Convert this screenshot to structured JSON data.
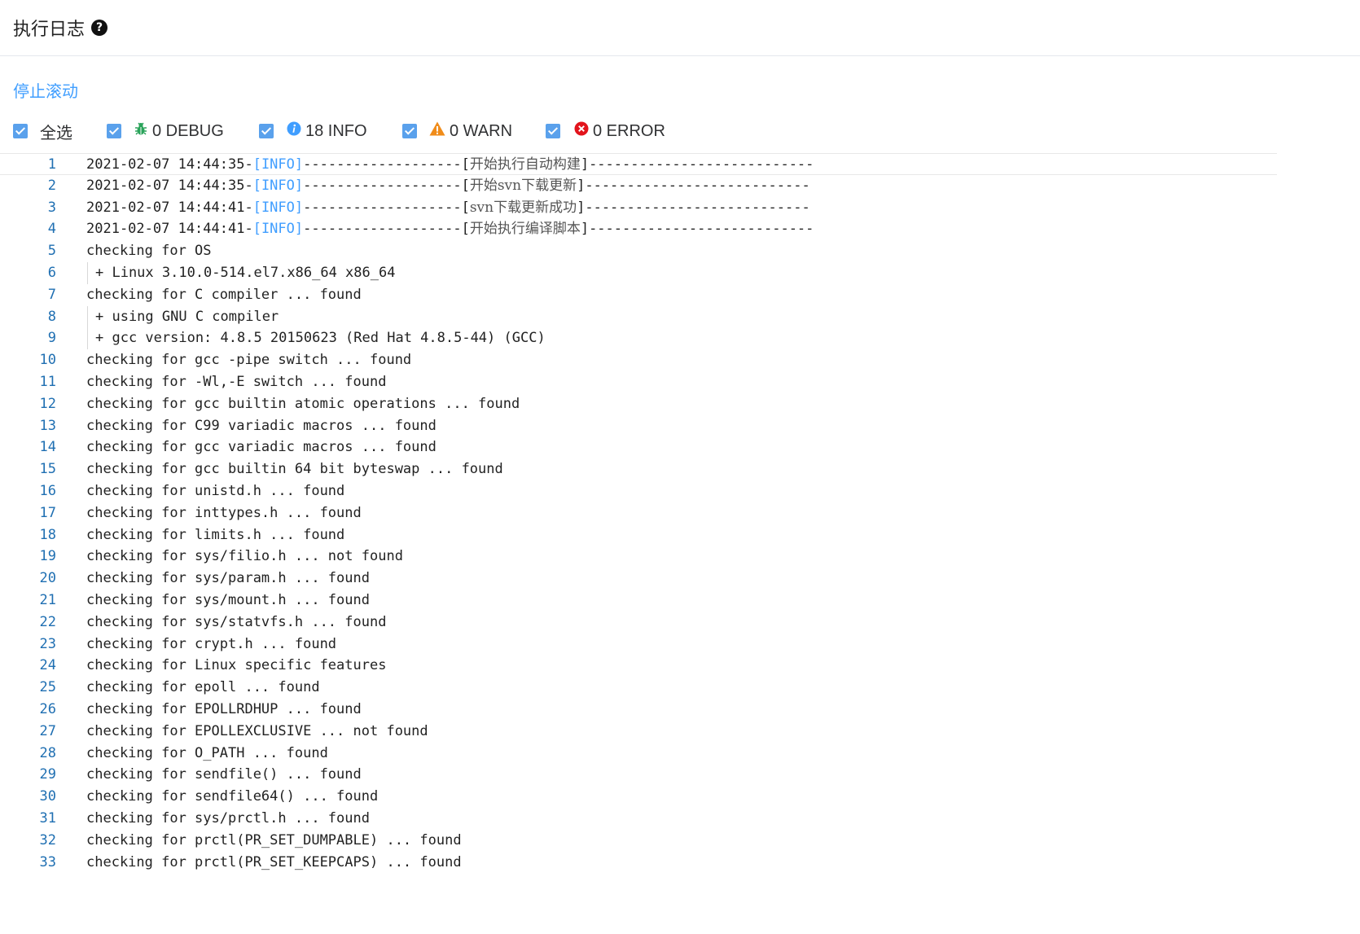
{
  "header": {
    "title": "执行日志",
    "help_icon": "question-circle-icon"
  },
  "toolbar": {
    "stop_scroll": "停止滚动"
  },
  "filters": {
    "select_all": "全选",
    "items": [
      {
        "icon": "bug-icon",
        "label": "0 DEBUG",
        "color": "#2aa35a"
      },
      {
        "icon": "info-circle-icon",
        "label": "18 INFO",
        "color": "#409eff"
      },
      {
        "icon": "warning-triangle-icon",
        "label": "0 WARN",
        "color": "#f08c1a"
      },
      {
        "icon": "error-circle-icon",
        "label": "0 ERROR",
        "color": "#e2141c"
      }
    ]
  },
  "colors": {
    "accent": "#409eff",
    "checkbox": "#5aa1ec",
    "line_number": "#1f6fb2"
  },
  "log": {
    "lines": [
      {
        "n": "1",
        "ts": "2021-02-07 14:44:35-",
        "tag": "[INFO]",
        "dash1": "-------------------[",
        "cn": "开始执行自动构建",
        "dash2": "]---------------------------"
      },
      {
        "n": "2",
        "ts": "2021-02-07 14:44:35-",
        "tag": "[INFO]",
        "dash1": "-------------------[",
        "cn": "开始svn下载更新",
        "dash2": "]---------------------------"
      },
      {
        "n": "3",
        "ts": "2021-02-07 14:44:41-",
        "tag": "[INFO]",
        "dash1": "-------------------[",
        "cn": "svn下载更新成功",
        "dash2": "]---------------------------"
      },
      {
        "n": "4",
        "ts": "2021-02-07 14:44:41-",
        "tag": "[INFO]",
        "dash1": "-------------------[",
        "cn": "开始执行编译脚本",
        "dash2": "]---------------------------"
      },
      {
        "n": "5",
        "text": "checking for OS"
      },
      {
        "n": "6",
        "text": " + Linux 3.10.0-514.el7.x86_64 x86_64",
        "indent": true
      },
      {
        "n": "7",
        "text": "checking for C compiler ... found"
      },
      {
        "n": "8",
        "text": " + using GNU C compiler",
        "indent": true
      },
      {
        "n": "9",
        "text": " + gcc version: 4.8.5 20150623 (Red Hat 4.8.5-44) (GCC)",
        "indent": true
      },
      {
        "n": "10",
        "text": "checking for gcc -pipe switch ... found"
      },
      {
        "n": "11",
        "text": "checking for -Wl,-E switch ... found"
      },
      {
        "n": "12",
        "text": "checking for gcc builtin atomic operations ... found"
      },
      {
        "n": "13",
        "text": "checking for C99 variadic macros ... found"
      },
      {
        "n": "14",
        "text": "checking for gcc variadic macros ... found"
      },
      {
        "n": "15",
        "text": "checking for gcc builtin 64 bit byteswap ... found"
      },
      {
        "n": "16",
        "text": "checking for unistd.h ... found"
      },
      {
        "n": "17",
        "text": "checking for inttypes.h ... found"
      },
      {
        "n": "18",
        "text": "checking for limits.h ... found"
      },
      {
        "n": "19",
        "text": "checking for sys/filio.h ... not found"
      },
      {
        "n": "20",
        "text": "checking for sys/param.h ... found"
      },
      {
        "n": "21",
        "text": "checking for sys/mount.h ... found"
      },
      {
        "n": "22",
        "text": "checking for sys/statvfs.h ... found"
      },
      {
        "n": "23",
        "text": "checking for crypt.h ... found"
      },
      {
        "n": "24",
        "text": "checking for Linux specific features"
      },
      {
        "n": "25",
        "text": "checking for epoll ... found"
      },
      {
        "n": "26",
        "text": "checking for EPOLLRDHUP ... found"
      },
      {
        "n": "27",
        "text": "checking for EPOLLEXCLUSIVE ... not found"
      },
      {
        "n": "28",
        "text": "checking for O_PATH ... found"
      },
      {
        "n": "29",
        "text": "checking for sendfile() ... found"
      },
      {
        "n": "30",
        "text": "checking for sendfile64() ... found"
      },
      {
        "n": "31",
        "text": "checking for sys/prctl.h ... found"
      },
      {
        "n": "32",
        "text": "checking for prctl(PR_SET_DUMPABLE) ... found"
      },
      {
        "n": "33",
        "text": "checking for prctl(PR_SET_KEEPCAPS) ... found"
      }
    ]
  }
}
